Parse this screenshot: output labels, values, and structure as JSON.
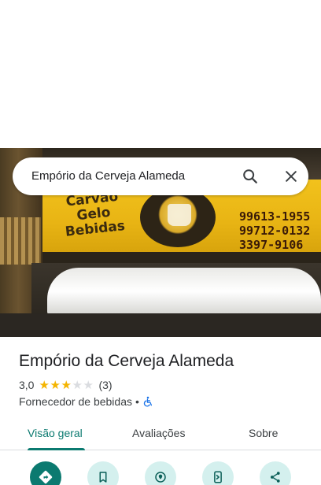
{
  "search": {
    "query": "Empório da Cerveja Alameda",
    "search_icon": "search-icon",
    "close_icon": "close-icon"
  },
  "photo": {
    "sign_text": [
      "Carvão",
      "Gelo",
      "Bebidas"
    ],
    "phones": [
      "99613-1955",
      "99712-0132",
      "3397-9106"
    ]
  },
  "place": {
    "name": "Empório da Cerveja Alameda",
    "rating": "3,0",
    "rating_value": 3,
    "rating_max": 5,
    "review_count": "(3)",
    "category": "Fornecedor de bebidas",
    "separator": "•",
    "accessibility_icon": "wheelchair-icon"
  },
  "tabs": [
    {
      "label": "Visão geral",
      "active": true
    },
    {
      "label": "Avaliações",
      "active": false
    },
    {
      "label": "Sobre",
      "active": false
    }
  ],
  "actions": [
    {
      "icon": "directions-icon"
    },
    {
      "icon": "bookmark-icon"
    },
    {
      "icon": "nearby-icon"
    },
    {
      "icon": "send-to-phone-icon"
    },
    {
      "icon": "share-icon"
    }
  ],
  "colors": {
    "accent": "#0b7a70",
    "accent_light": "#d4f0ee",
    "star": "#f4b400",
    "star_empty": "#dadce0",
    "accessibility": "#1a73e8"
  }
}
